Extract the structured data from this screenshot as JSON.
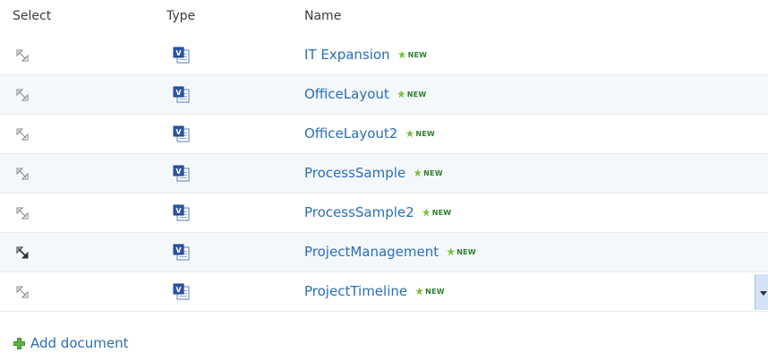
{
  "columns": {
    "select": "Select",
    "type": "Type",
    "name": "Name"
  },
  "badge_new": "NEW",
  "rows": [
    {
      "name": "IT Expansion",
      "selected": false
    },
    {
      "name": "OfficeLayout",
      "selected": false
    },
    {
      "name": "OfficeLayout2",
      "selected": false
    },
    {
      "name": "ProcessSample",
      "selected": false
    },
    {
      "name": "ProcessSample2",
      "selected": false
    },
    {
      "name": "ProjectManagement",
      "selected": true
    },
    {
      "name": "ProjectTimeline",
      "selected": false
    }
  ],
  "add_label": "Add document",
  "colors": {
    "link": "#2b6eb4",
    "new_star": "#7cbf3a",
    "new_text": "#2d7d2d",
    "alt_row": "#f5f8fb",
    "menu_bg": "#d3e3f5"
  },
  "icons": {
    "select": "select-checkbox-icon",
    "type": "visio-document-icon",
    "add": "green-plus-icon",
    "menu": "dropdown-arrow-icon"
  }
}
